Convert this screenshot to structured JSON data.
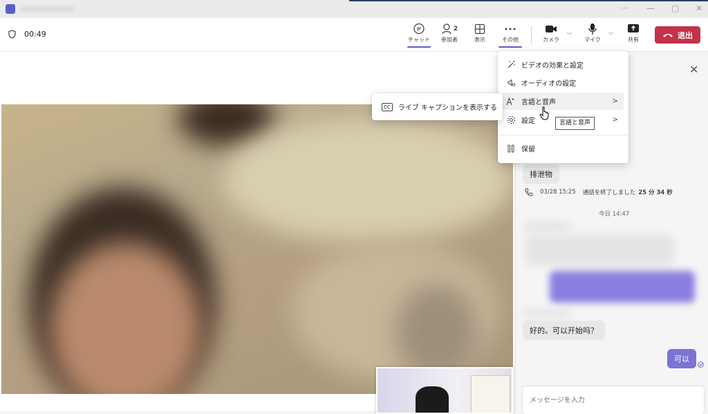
{
  "window": {
    "minimize": "—",
    "maximize": "▢",
    "more": "···",
    "close": "✕"
  },
  "call": {
    "timer": "00:49"
  },
  "toolbar": {
    "chat": "チャット",
    "participants": "参加者",
    "participants_count": "2",
    "view": "表示",
    "more": "その他",
    "camera": "カメラ",
    "mic": "マイク",
    "share": "共有",
    "leave": "退出"
  },
  "more_menu": {
    "items": [
      {
        "label": "ビデオの効果と設定",
        "icon": "magic-wand-icon"
      },
      {
        "label": "オーディオの設定",
        "icon": "speaker-gear-icon"
      },
      {
        "label": "言語と音声",
        "icon": "language-icon"
      },
      {
        "label": "設定",
        "icon": "gear-icon"
      },
      {
        "label": "保留",
        "icon": "pause-icon"
      }
    ]
  },
  "submenu": {
    "captions": "ライブ キャプションを表示する",
    "cc_icon": "CC"
  },
  "tooltip": "言語と音声",
  "chat": {
    "partial_message": "排泄物",
    "call_date": "03/28 15:25",
    "call_ended": "通話を終了しました",
    "call_duration": "25 分 34 秒",
    "today": "今日 14:47",
    "message_in": "好的。可以开始吗？",
    "message_out": "可以",
    "compose_placeholder": "メッセージを入力"
  },
  "colors": {
    "accent": "#5b5fc7",
    "leave": "#c4314b",
    "my_bubble": "#7b74d4"
  }
}
